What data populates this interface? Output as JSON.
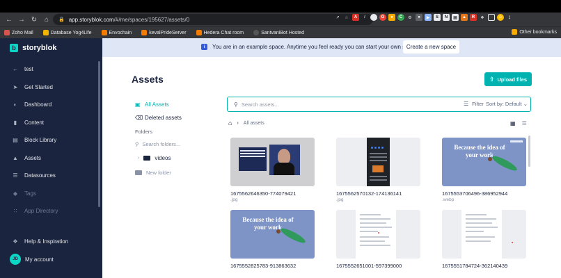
{
  "browser": {
    "url_host": "app.storyblok.com",
    "url_path": "/#/me/spaces/195627/assets/0",
    "bookmarks": [
      {
        "label": "Zoho Mail",
        "color": "#d9534f"
      },
      {
        "label": "Database Yog4Life",
        "color": "#f4b400"
      },
      {
        "label": "Envochain",
        "color": "#f57c00"
      },
      {
        "label": "kevalPrideServer",
        "color": "#f57c00"
      },
      {
        "label": "Hedera Chat room",
        "color": "#f57c00"
      },
      {
        "label": "SantvaniBot Hosted",
        "color": "#555555"
      }
    ],
    "other_bookmarks": "Other bookmarks"
  },
  "sidebar": {
    "brand": "storyblok",
    "back_label": "test",
    "items": [
      {
        "label": "Get Started",
        "icon": "rocket-icon"
      },
      {
        "label": "Dashboard",
        "icon": "dashboard-icon"
      },
      {
        "label": "Content",
        "icon": "content-icon"
      },
      {
        "label": "Block Library",
        "icon": "block-library-icon"
      },
      {
        "label": "Assets",
        "icon": "assets-icon"
      },
      {
        "label": "Datasources",
        "icon": "datasources-icon"
      },
      {
        "label": "Tags",
        "icon": "tag-icon"
      },
      {
        "label": "App Directory",
        "icon": "app-directory-icon"
      }
    ],
    "help_label": "Help & Inspiration",
    "account_label": "My account",
    "avatar_initials": "JD"
  },
  "banner": {
    "text": "You are in an example space. Anytime you feel ready you can start your own space.",
    "button": "Create a new space"
  },
  "page": {
    "title": "Assets",
    "upload_button": "Upload files"
  },
  "left_panel": {
    "all_assets": "All Assets",
    "deleted_assets": "Deleted assets",
    "folders_label": "Folders",
    "search_folders_placeholder": "Search folders...",
    "folders": [
      "videos"
    ],
    "new_folder": "New folder"
  },
  "search": {
    "placeholder": "Search assets...",
    "filter_label": "Filter",
    "sort_label": "Sort by: Default"
  },
  "breadcrumb": {
    "current": "All assets"
  },
  "assets": [
    {
      "name": "1675562646350-774079421",
      "ext": ".jpg",
      "thumb": "photo"
    },
    {
      "name": "1675562570132-174136141",
      "ext": ".jpg",
      "thumb": "phone"
    },
    {
      "name": "1675553706496-386952944",
      "ext": ".webp",
      "thumb": "hero",
      "thumb_text": "Because the idea of your work"
    },
    {
      "name": "1675552825783-913863632",
      "ext": "",
      "thumb": "hero",
      "thumb_text": "Because the idea of your work"
    },
    {
      "name": "1675552651001-597399000",
      "ext": "",
      "thumb": "doc"
    },
    {
      "name": "1675551784724-362140439",
      "ext": "",
      "thumb": "doc"
    }
  ]
}
